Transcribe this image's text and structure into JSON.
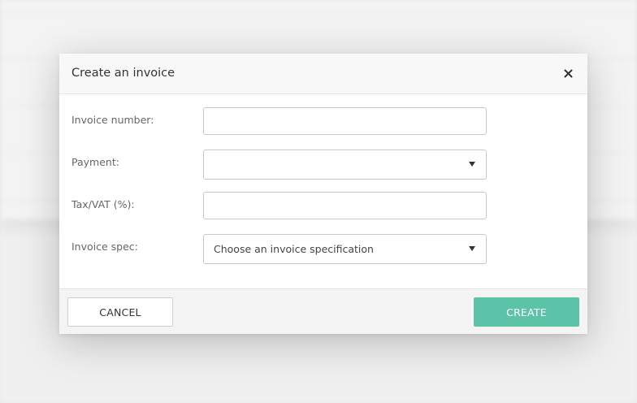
{
  "colors": {
    "primary": "#5dc3a8"
  },
  "modal": {
    "title": "Create an invoice",
    "close_icon": "close-icon",
    "fields": {
      "invoice_number": {
        "label": "Invoice number:",
        "value": ""
      },
      "payment": {
        "label": "Payment:",
        "selected": ""
      },
      "tax_vat": {
        "label": "Tax/VAT (%):",
        "value": ""
      },
      "invoice_spec": {
        "label": "Invoice spec:",
        "selected": "Choose an invoice specification"
      }
    },
    "footer": {
      "cancel_label": "CANCEL",
      "create_label": "CREATE"
    }
  }
}
